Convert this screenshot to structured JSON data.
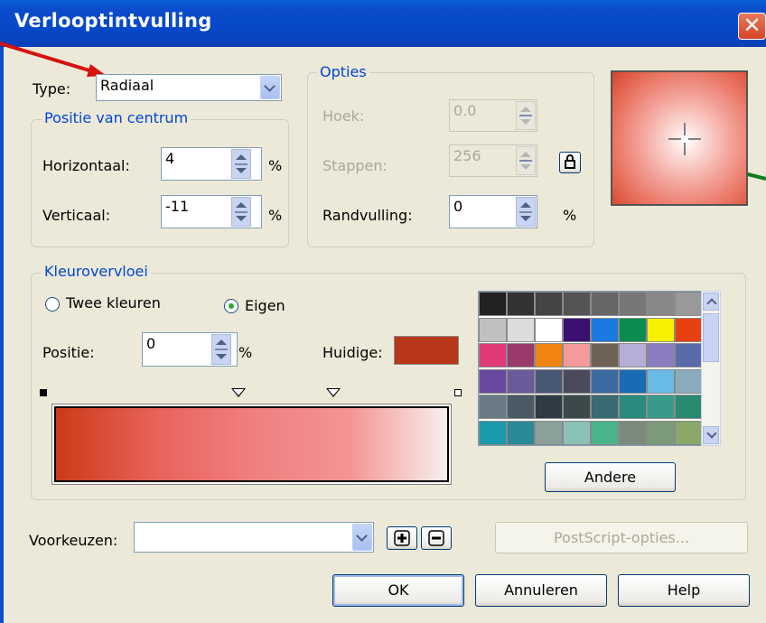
{
  "window": {
    "title": "Verlooptintvulling"
  },
  "type_field": {
    "label": "Type:",
    "value": "Radiaal"
  },
  "positie_centrum": {
    "legend": "Positie van centrum",
    "horizontaal": {
      "label": "Horizontaal:",
      "value": "4",
      "unit": "%"
    },
    "verticaal": {
      "label": "Verticaal:",
      "value": "-11",
      "unit": "%"
    }
  },
  "opties": {
    "legend": "Opties",
    "hoek": {
      "label": "Hoek:",
      "value": "0.0"
    },
    "stappen": {
      "label": "Stappen:",
      "value": "256"
    },
    "randvulling": {
      "label": "Randvulling:",
      "value": "0",
      "unit": "%"
    }
  },
  "kleurovervloei": {
    "legend": "Kleurovervloei",
    "twee_kleuren": "Twee kleuren",
    "eigen": "Eigen",
    "selected": "eigen",
    "positie": {
      "label": "Positie:",
      "value": "0",
      "unit": "%"
    },
    "huidige_label": "Huidige:",
    "huidige_color": "#b8361a",
    "gradient_colors": [
      "#cc3a16",
      "#e8625a",
      "#f07f7f",
      "#f49494",
      "#f7f0ee"
    ],
    "andere_button": "Andere"
  },
  "palette": [
    [
      "#222222",
      "#333333",
      "#444444",
      "#555555",
      "#666666",
      "#777777",
      "#888888",
      "#999999"
    ],
    [
      "#c0c0c0",
      "#dcdcdc",
      "#ffffff",
      "#3a1070",
      "#1a7ae0",
      "#0a8c50",
      "#f8f000",
      "#e84010"
    ],
    [
      "#e03a78",
      "#9a3a6a",
      "#f08410",
      "#f49a9a",
      "#6e6255",
      "#b6aed6",
      "#8a7cbe",
      "#5a6aaa"
    ],
    [
      "#6a4aa0",
      "#6a5a9a",
      "#4a5878",
      "#4a4a5a",
      "#3a6aa0",
      "#1a6ab4",
      "#6abae8",
      "#8aaabe"
    ],
    [
      "#6a7a86",
      "#4a5a66",
      "#2e3a44",
      "#3a4a4a",
      "#3a6a72",
      "#2a8a80",
      "#3a9a8a",
      "#2a8a70"
    ],
    [
      "#1a9aaa",
      "#2a8a9a",
      "#8aa09a",
      "#8ac0b6",
      "#4ab48c",
      "#7a8a7a",
      "#7a9a7a",
      "#8aa86a"
    ]
  ],
  "voorkeuzen": {
    "label": "Voorkeuzen:",
    "value": ""
  },
  "buttons": {
    "postscript": "PostScript-opties...",
    "ok": "OK",
    "annuleren": "Annuleren",
    "help": "Help"
  },
  "colors": {
    "accent": "#0046d5",
    "title_bar": "#0548c8"
  }
}
